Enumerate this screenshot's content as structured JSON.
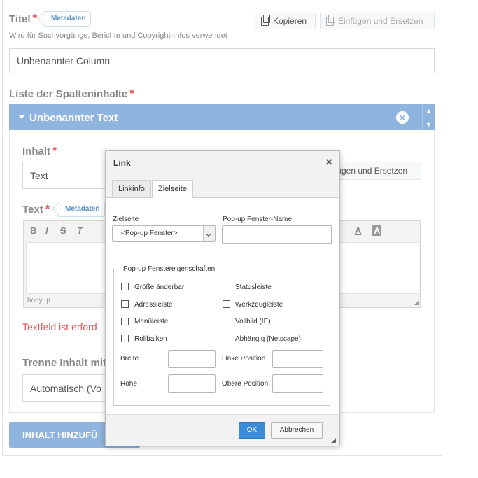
{
  "form": {
    "title_label": "Titel",
    "metadata_tag": "Metadaten",
    "copy_button": "Kopieren",
    "paste_replace_button": "Einfügen und Ersetzen",
    "title_hint": "Wird für Suchvorgänge, Berichte und Copyright-Infos verwendet",
    "title_value": "Unbenannter Column",
    "column_content_label": "Liste der Spalteninhalte"
  },
  "accordion": {
    "header_title": "Unbenannter Text",
    "content_label": "Inhalt",
    "content_value": "Text",
    "paste_replace_partial": "fügen und Ersetzen",
    "text_label": "Text",
    "text_metadata_tag": "Metadaten",
    "editor_path": [
      "body",
      "p"
    ],
    "error_partial": "Textfeld ist erford",
    "separate_label_partial": "Trenne Inhalt mit",
    "separate_value_partial": "Automatisch (Vo",
    "add_content_partial": "INHALT HINZUFÜ"
  },
  "dialog": {
    "title": "Link",
    "tabs": [
      "Linkinfo",
      "Zielseite"
    ],
    "active_tab": "Zielseite",
    "target_label": "Zielseite",
    "target_value": "<Pop-up Fenster>",
    "popup_name_label": "Pop-up Fenster-Name",
    "popup_name_value": "",
    "props_legend": "Pop-up Fenstereigenschaften",
    "checkboxes_left": [
      "Größe änderbar",
      "Adressleiste",
      "Menüleiste",
      "Rollbalken"
    ],
    "checkboxes_right": [
      "Statusleiste",
      "Werkzeugleiste",
      "Vollbild (IE)",
      "Abhängig (Netscape)"
    ],
    "width_label": "Breite",
    "height_label": "Höhe",
    "left_pos_label": "Linke Position",
    "top_pos_label": "Obere Position",
    "ok_label": "OK",
    "cancel_label": "Abbrechen"
  },
  "colors": {
    "accent": "#8fb4de",
    "required": "#e05656",
    "ok_button": "#3a8bd8"
  }
}
